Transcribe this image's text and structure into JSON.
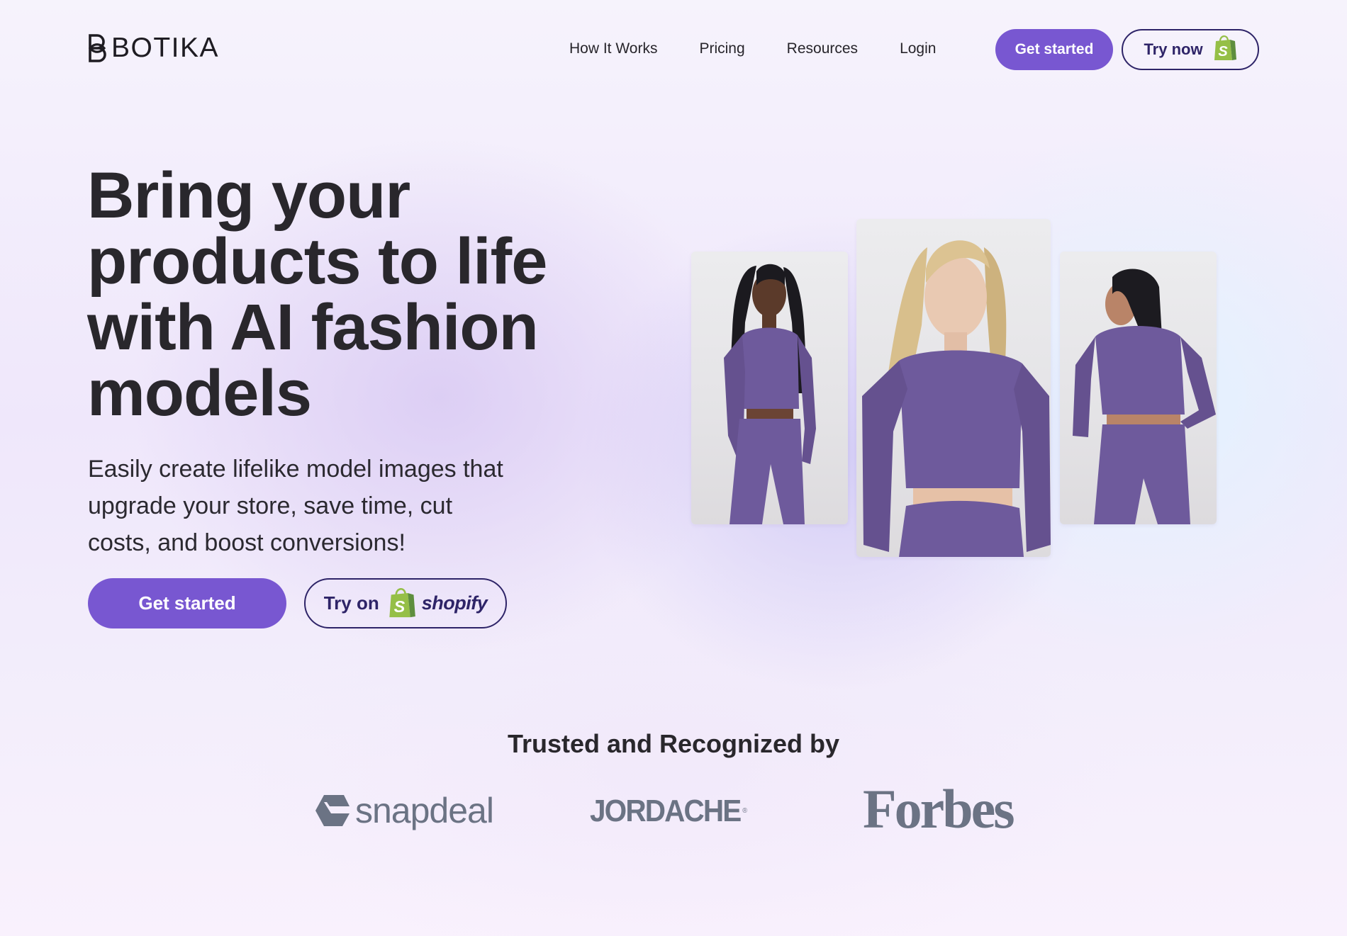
{
  "brand": {
    "name": "BOTIKA",
    "logo_icon": "botika-mark-icon"
  },
  "nav": {
    "items": [
      {
        "label": "How It Works"
      },
      {
        "label": "Pricing"
      },
      {
        "label": "Resources"
      },
      {
        "label": "Login"
      }
    ],
    "get_started_label": "Get started",
    "try_now_label": "Try now",
    "try_now_icon": "shopify-bag-icon"
  },
  "hero": {
    "headline_lines": [
      "Bring your",
      "products to life",
      "with AI fashion",
      "models"
    ],
    "subtitle_lines": [
      "Easily create lifelike model images that",
      "upgrade your store, save time, cut",
      "costs, and boost conversions!"
    ],
    "cta_primary_label": "Get started",
    "cta_secondary_label": "Try on",
    "cta_secondary_brand": "shopify",
    "cta_secondary_icon": "shopify-bag-icon",
    "images": [
      {
        "alt": "Model in purple crop top and leggings, front view",
        "name": "model-image-left"
      },
      {
        "alt": "Blonde model in purple crop top and leggings",
        "name": "model-image-center"
      },
      {
        "alt": "Model in purple crop top and leggings, back view",
        "name": "model-image-right"
      }
    ]
  },
  "trusted": {
    "title": "Trusted and Recognized by",
    "logos": [
      {
        "name": "snapdeal",
        "text": "snapdeal"
      },
      {
        "name": "jordache",
        "text": "JORDACHE",
        "mark": "®"
      },
      {
        "name": "forbes",
        "text": "Forbes"
      }
    ]
  },
  "colors": {
    "accent": "#7857d1",
    "outline": "#2e2468",
    "text": "#29272c",
    "logo_gray": "#6b7384",
    "shopify_green": "#95bf47",
    "outfit_purple": "#6e5a9c"
  }
}
